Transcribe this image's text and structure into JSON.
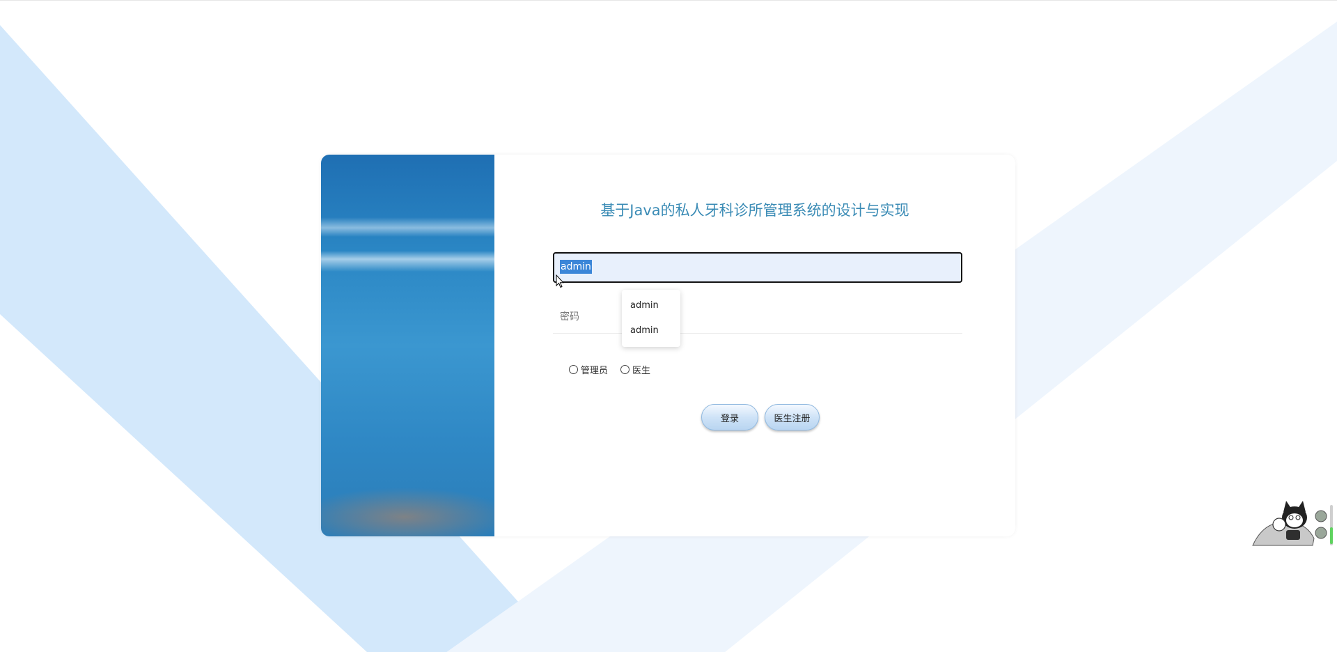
{
  "title": "基于Java的私人牙科诊所管理系统的设计与实现",
  "username": {
    "value": "admin",
    "selected_text": "admin"
  },
  "password": {
    "placeholder": "密码",
    "value": ""
  },
  "autocomplete": {
    "items": [
      "admin",
      "admin"
    ]
  },
  "roles": [
    {
      "label": "管理员",
      "checked": false
    },
    {
      "label": "医生",
      "checked": false
    }
  ],
  "buttons": {
    "login": "登录",
    "register": "医生注册"
  },
  "colors": {
    "title": "#3a8bb5",
    "background_shape_strong": "#d3e8fb",
    "background_shape_light": "#eef5fd",
    "button_gradient_top": "#f4f9ff",
    "button_gradient_bottom": "#b9d5f1"
  },
  "icons": {
    "mouse_cursor": "cursor-arrow-icon",
    "mascot": "cat-mascot-icon"
  }
}
